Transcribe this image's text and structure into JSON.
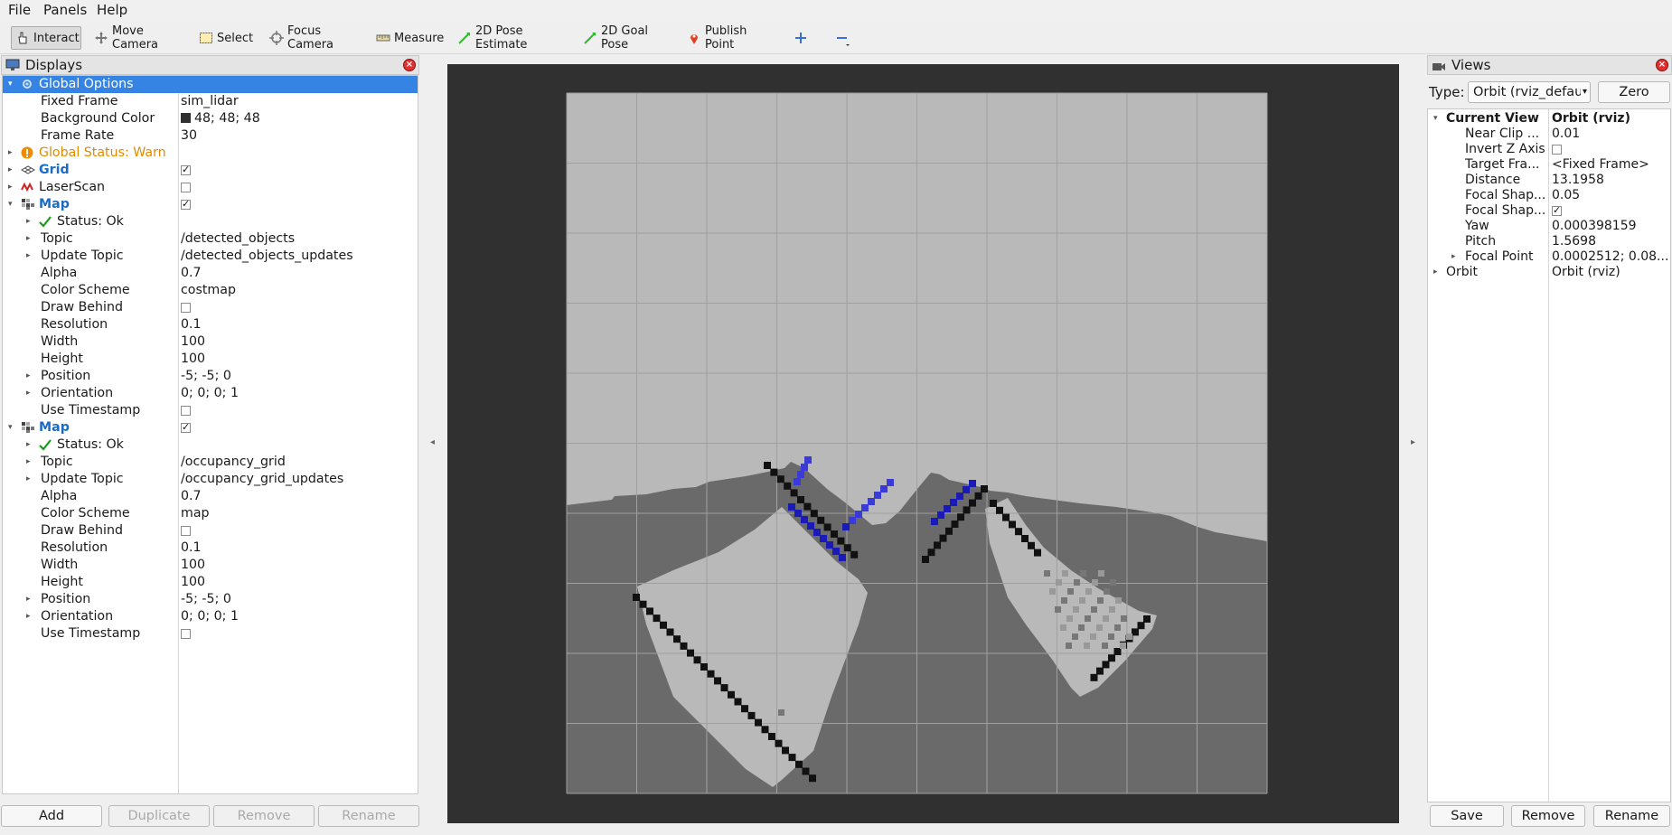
{
  "menubar": {
    "file": "File",
    "panels": "Panels",
    "help": "Help"
  },
  "toolbar": {
    "interact": "Interact",
    "move_camera": "Move Camera",
    "select": "Select",
    "focus_camera": "Focus Camera",
    "measure": "Measure",
    "pose_estimate": "2D Pose Estimate",
    "goal_pose": "2D Goal Pose",
    "publish_point": "Publish Point"
  },
  "displays": {
    "title": "Displays",
    "rows": [
      {
        "name": "Global Options",
        "value": "",
        "level": 0,
        "arrow": "down",
        "icon": "gear-icon",
        "style": "selected"
      },
      {
        "name": "Fixed Frame",
        "value": "sim_lidar",
        "level": 1
      },
      {
        "name": "Background Color",
        "value": "48; 48; 48",
        "level": 1,
        "swatch": "#303030"
      },
      {
        "name": "Frame Rate",
        "value": "30",
        "level": 1
      },
      {
        "name": "Global Status: Warn",
        "value": "",
        "level": 0,
        "arrow": "right",
        "icon": "warning-icon",
        "style": "warn"
      },
      {
        "name": "Grid",
        "value": "",
        "level": 0,
        "arrow": "right",
        "icon": "grid-icon",
        "style": "blue",
        "check": "checked"
      },
      {
        "name": "LaserScan",
        "value": "",
        "level": 0,
        "arrow": "right",
        "icon": "laserscan-icon",
        "check": "unchecked"
      },
      {
        "name": "Map",
        "value": "",
        "level": 0,
        "arrow": "down",
        "icon": "map-icon",
        "style": "blue",
        "check": "checked"
      },
      {
        "name": "Status: Ok",
        "value": "",
        "level": 1,
        "arrow": "right",
        "icon": "ok-check-icon"
      },
      {
        "name": "Topic",
        "value": "/detected_objects",
        "level": 1,
        "arrow": "right"
      },
      {
        "name": "Update Topic",
        "value": "/detected_objects_updates",
        "level": 1,
        "arrow": "right"
      },
      {
        "name": "Alpha",
        "value": "0.7",
        "level": 1
      },
      {
        "name": "Color Scheme",
        "value": "costmap",
        "level": 1
      },
      {
        "name": "Draw Behind",
        "value": "",
        "level": 1,
        "check": "unchecked"
      },
      {
        "name": "Resolution",
        "value": "0.1",
        "level": 1
      },
      {
        "name": "Width",
        "value": "100",
        "level": 1
      },
      {
        "name": "Height",
        "value": "100",
        "level": 1
      },
      {
        "name": "Position",
        "value": "-5; -5; 0",
        "level": 1,
        "arrow": "right"
      },
      {
        "name": "Orientation",
        "value": "0; 0; 0; 1",
        "level": 1,
        "arrow": "right"
      },
      {
        "name": "Use Timestamp",
        "value": "",
        "level": 1,
        "check": "unchecked"
      },
      {
        "name": "Map",
        "value": "",
        "level": 0,
        "arrow": "down",
        "icon": "map-icon",
        "style": "blue",
        "check": "checked"
      },
      {
        "name": "Status: Ok",
        "value": "",
        "level": 1,
        "arrow": "right",
        "icon": "ok-check-icon"
      },
      {
        "name": "Topic",
        "value": "/occupancy_grid",
        "level": 1,
        "arrow": "right"
      },
      {
        "name": "Update Topic",
        "value": "/occupancy_grid_updates",
        "level": 1,
        "arrow": "right"
      },
      {
        "name": "Alpha",
        "value": "0.7",
        "level": 1
      },
      {
        "name": "Color Scheme",
        "value": "map",
        "level": 1
      },
      {
        "name": "Draw Behind",
        "value": "",
        "level": 1,
        "check": "unchecked"
      },
      {
        "name": "Resolution",
        "value": "0.1",
        "level": 1
      },
      {
        "name": "Width",
        "value": "100",
        "level": 1
      },
      {
        "name": "Height",
        "value": "100",
        "level": 1
      },
      {
        "name": "Position",
        "value": "-5; -5; 0",
        "level": 1,
        "arrow": "right"
      },
      {
        "name": "Orientation",
        "value": "0; 0; 0; 1",
        "level": 1,
        "arrow": "right"
      },
      {
        "name": "Use Timestamp",
        "value": "",
        "level": 1,
        "check": "unchecked"
      }
    ],
    "buttons": {
      "add": "Add",
      "duplicate": "Duplicate",
      "remove": "Remove",
      "rename": "Rename"
    }
  },
  "views": {
    "title": "Views",
    "type_label": "Type:",
    "type_value": "Orbit (rviz_defau",
    "zero": "Zero",
    "rows": [
      {
        "name": "Current View",
        "value": "Orbit (rviz)",
        "level": 0,
        "arrow": "down",
        "bold": true
      },
      {
        "name": "Near Clip ...",
        "value": "0.01",
        "level": 1
      },
      {
        "name": "Invert Z Axis",
        "value": "",
        "level": 1,
        "check": "unchecked"
      },
      {
        "name": "Target Fra...",
        "value": "<Fixed Frame>",
        "level": 1
      },
      {
        "name": "Distance",
        "value": "13.1958",
        "level": 1
      },
      {
        "name": "Focal Shap...",
        "value": "0.05",
        "level": 1
      },
      {
        "name": "Focal Shap...",
        "value": "",
        "level": 1,
        "check": "checked"
      },
      {
        "name": "Yaw",
        "value": "0.000398159",
        "level": 1
      },
      {
        "name": "Pitch",
        "value": "1.5698",
        "level": 1
      },
      {
        "name": "Focal Point",
        "value": "0.0002512; 0.08...",
        "level": 1,
        "arrow": "right"
      },
      {
        "name": "Orbit",
        "value": "Orbit (rviz)",
        "level": 0,
        "arrow": "right"
      }
    ],
    "buttons": {
      "save": "Save",
      "remove": "Remove",
      "rename": "Rename"
    }
  },
  "viewport": {
    "background_color": "#303030",
    "map_light": "#b9b9b9",
    "map_dark": "#6a6a6a",
    "laser_color": "#1a1ab8"
  }
}
